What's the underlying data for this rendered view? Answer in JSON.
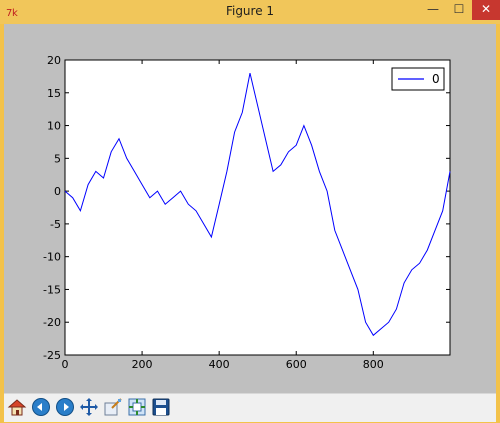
{
  "window": {
    "title": "Figure 1",
    "min_label": "—",
    "max_label": "☐",
    "close_label": "✕"
  },
  "toolbar": {
    "buttons": [
      {
        "name": "home-icon"
      },
      {
        "name": "back-icon"
      },
      {
        "name": "forward-icon"
      },
      {
        "name": "pan-icon"
      },
      {
        "name": "zoom-icon"
      },
      {
        "name": "configure-subplots-icon"
      },
      {
        "name": "save-icon"
      }
    ]
  },
  "chart_data": {
    "type": "line",
    "xlim": [
      0,
      999
    ],
    "ylim": [
      -25,
      20
    ],
    "xticks": [
      0,
      200,
      400,
      600,
      800
    ],
    "yticks": [
      20,
      15,
      10,
      5,
      0,
      -5,
      -10,
      -15,
      -20,
      -25
    ],
    "series": [
      {
        "name": "0",
        "color": "#0000ff",
        "x": [
          0,
          20,
          40,
          60,
          80,
          100,
          120,
          140,
          160,
          180,
          200,
          220,
          240,
          260,
          280,
          300,
          320,
          340,
          360,
          380,
          400,
          420,
          440,
          460,
          480,
          500,
          520,
          540,
          560,
          580,
          600,
          620,
          640,
          660,
          680,
          700,
          720,
          740,
          760,
          780,
          800,
          820,
          840,
          860,
          880,
          900,
          920,
          940,
          960,
          980,
          999
        ],
        "y": [
          0,
          -1,
          -3,
          1,
          3,
          2,
          6,
          8,
          5,
          3,
          1,
          -1,
          0,
          -2,
          -1,
          0,
          -2,
          -3,
          -5,
          -7,
          -2,
          3,
          9,
          12,
          18,
          13,
          8,
          3,
          4,
          6,
          7,
          10,
          7,
          3,
          0,
          -6,
          -9,
          -12,
          -15,
          -20,
          -22,
          -21,
          -20,
          -18,
          -14,
          -12,
          -11,
          -9,
          -6,
          -3,
          3
        ]
      }
    ],
    "legend": {
      "position": "top-right"
    }
  }
}
